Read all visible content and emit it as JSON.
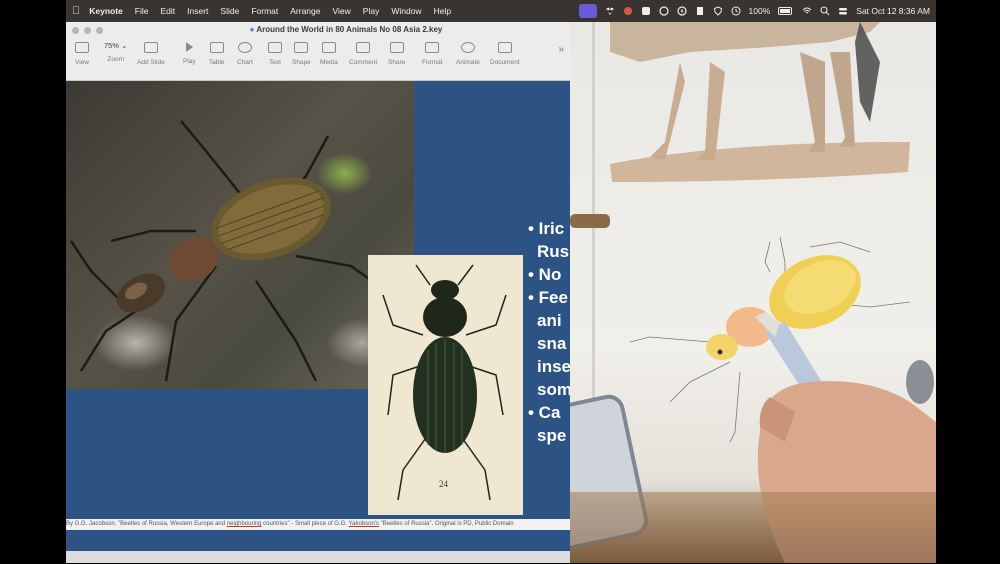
{
  "menubar": {
    "apple_icon": "apple-icon",
    "app_name": "Keynote",
    "menus": [
      "File",
      "Edit",
      "Insert",
      "Slide",
      "Format",
      "Arrange",
      "View",
      "Play",
      "Window",
      "Help"
    ],
    "battery": "100%",
    "clock": "Sat Oct 12  8:36 AM"
  },
  "keynote": {
    "title": "Around the World in 80 Animals No 08 Asia 2.key",
    "zoom_value": "75%",
    "toolbar": {
      "view": "View",
      "zoom": "Zoom",
      "add_slide": "Add Slide",
      "play": "Play",
      "table": "Table",
      "chart": "Chart",
      "text": "Text",
      "shape": "Shape",
      "media": "Media",
      "comment": "Comment",
      "share": "Share",
      "format": "Format",
      "animate": "Animate",
      "document": "Document"
    },
    "slide": {
      "bullets": [
        "• Iric",
        "Rus",
        "• No",
        "• Fee",
        "ani",
        "sna",
        "inse",
        "som",
        "• Ca",
        "spe"
      ],
      "engraving_number": "24",
      "credit_pre": "By G.G. Jacobson, \"Beetles of Russia, Western Europe and ",
      "credit_u1": "neighbouring",
      "credit_mid": " countries\" - Small piece of G.G. ",
      "credit_u2": "Yakobson's",
      "credit_post": " \"Beetles of Russia\". Original is PD, Public Domain"
    }
  },
  "colors": {
    "slide_bg": "#2c5383",
    "menubar_bg": "#3a3430",
    "beetle_body": "#6b5a2f",
    "sketch_beetle": "#f0cf55"
  }
}
